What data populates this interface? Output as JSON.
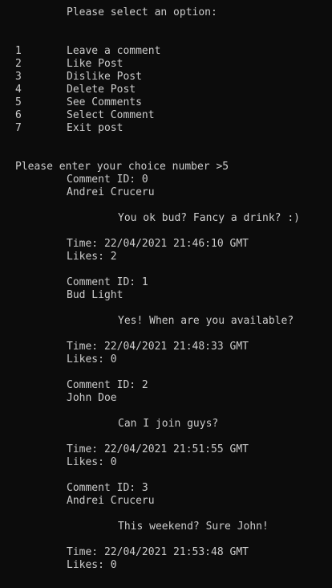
{
  "console": {
    "prompt_header": "Please select an option:",
    "menu": [
      {
        "number": "1",
        "label": "Leave a comment"
      },
      {
        "number": "2",
        "label": "Like Post"
      },
      {
        "number": "3",
        "label": "Dislike Post"
      },
      {
        "number": "4",
        "label": "Delete Post"
      },
      {
        "number": "5",
        "label": "See Comments"
      },
      {
        "number": "6",
        "label": "Select Comment"
      },
      {
        "number": "7",
        "label": "Exit post"
      }
    ],
    "choice_prompt": "Please enter your choice number >5",
    "comments": [
      {
        "id_line": "Comment ID: 0",
        "author": "Andrei Cruceru",
        "text": "You ok bud? Fancy a drink? :)",
        "time_line": "Time: 22/04/2021 21:46:10 GMT",
        "likes_line": "Likes: 2"
      },
      {
        "id_line": "Comment ID: 1",
        "author": "Bud Light",
        "text": "Yes! When are you available?",
        "time_line": "Time: 22/04/2021 21:48:33 GMT",
        "likes_line": "Likes: 0"
      },
      {
        "id_line": "Comment ID: 2",
        "author": "John Doe",
        "text": "Can I join guys?",
        "time_line": "Time: 22/04/2021 21:51:55 GMT",
        "likes_line": "Likes: 0"
      },
      {
        "id_line": "Comment ID: 3",
        "author": "Andrei Cruceru",
        "text": "This weekend? Sure John!",
        "time_line": "Time: 22/04/2021 21:53:48 GMT",
        "likes_line": "Likes: 0"
      }
    ]
  }
}
